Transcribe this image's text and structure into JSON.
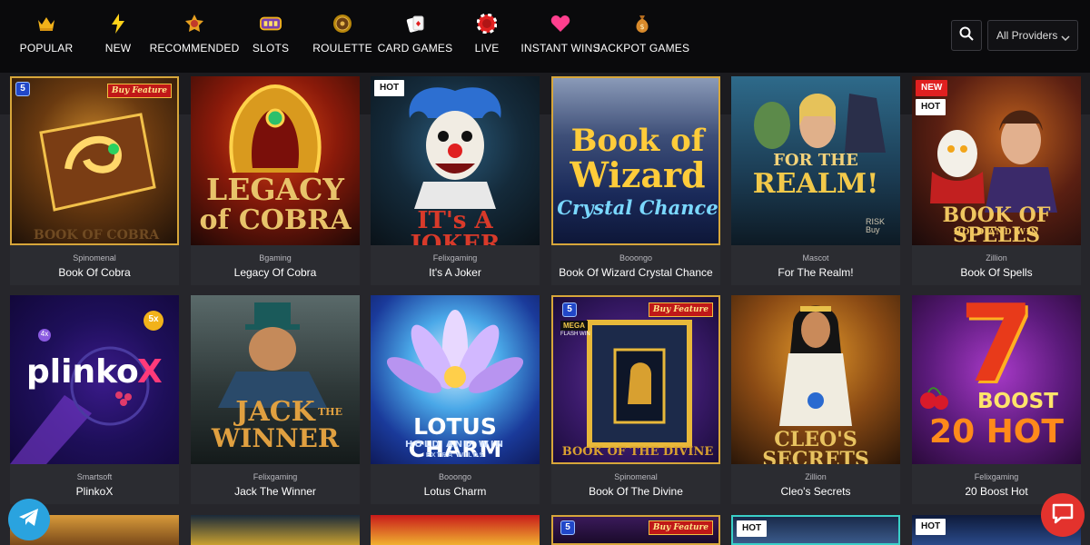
{
  "nav": {
    "items": [
      {
        "label": "POPULAR",
        "icon": "crown-icon"
      },
      {
        "label": "NEW",
        "icon": "lightning-icon"
      },
      {
        "label": "RECOMMENDED",
        "icon": "medal-icon"
      },
      {
        "label": "SLOTS",
        "icon": "slot-machine-icon"
      },
      {
        "label": "ROULETTE",
        "icon": "roulette-icon"
      },
      {
        "label": "CARD GAMES",
        "icon": "cards-icon"
      },
      {
        "label": "LIVE",
        "icon": "chip-icon"
      },
      {
        "label": "INSTANT WINS",
        "icon": "heart-icon"
      },
      {
        "label": "JACKPOT GAMES",
        "icon": "money-bag-icon"
      }
    ],
    "provider_select": {
      "value": "All Providers"
    }
  },
  "games": [
    {
      "provider": "Spinomenal",
      "name": "Book Of Cobra",
      "art_title": "BOOK OF COBRA",
      "badge": "",
      "buy_feature": "Buy Feature",
      "mark": "5"
    },
    {
      "provider": "Bgaming",
      "name": "Legacy Of Cobra",
      "art_title_1": "LEGACY",
      "art_title_2": "of COBRA"
    },
    {
      "provider": "Felixgaming",
      "name": "It's A Joker",
      "badge": "HOT",
      "art_title": "IT's A JOKER"
    },
    {
      "provider": "Booongo",
      "name": "Book Of Wizard Crystal Chance",
      "art_title_1": "Book of",
      "art_title_2": "Wizard",
      "art_title_3": "Crystal Chance"
    },
    {
      "provider": "Mascot",
      "name": "For The Realm!",
      "art_title_1": "FOR THE",
      "art_title_2": "REALM!",
      "art_sub": "RISK Buy"
    },
    {
      "provider": "Zillion",
      "name": "Book Of Spells",
      "badge_new": "NEW",
      "badge": "HOT",
      "art_title": "BOOK OF SPELLS",
      "art_sub": "HOLD AND WIN"
    },
    {
      "provider": "Smartsoft",
      "name": "PlinkoX",
      "art_title": "plinko",
      "art_x": "X",
      "art_mult": "5x",
      "art_mult2": "4x"
    },
    {
      "provider": "Felixgaming",
      "name": "Jack The Winner",
      "art_title_1": "JACK",
      "art_the": "THE",
      "art_title_2": "WINNER"
    },
    {
      "provider": "Booongo",
      "name": "Lotus Charm",
      "art_title": "LOTUS CHARM",
      "art_sub": "HOLD AND WIN",
      "art_sub2": "EXTRA WILDS"
    },
    {
      "provider": "Spinomenal",
      "name": "Book Of The Divine",
      "buy_feature": "Buy Feature",
      "mark": "5",
      "art_mega": "MEGA",
      "art_flash": "FLASH WIN",
      "art_title": "BOOK OF THE DIVINE"
    },
    {
      "provider": "Zillion",
      "name": "Cleo's Secrets",
      "art_title": "CLEO'S SECRETS"
    },
    {
      "provider": "Felixgaming",
      "name": "20 Boost Hot",
      "art_seven": "7",
      "art_boost": "BOOST",
      "art_title": "20 HOT"
    }
  ],
  "row3": [
    {
      "badge": ""
    },
    {
      "badge": ""
    },
    {
      "badge": ""
    },
    {
      "badge": "",
      "buy_feature": "Buy Feature",
      "mark": "5"
    },
    {
      "badge": "HOT"
    },
    {
      "badge": "HOT"
    }
  ],
  "colors": {
    "accent": "#d7a63a",
    "hot_badge": "#ffffff",
    "new_badge": "#e02020",
    "telegram": "#2aa3df",
    "chat": "#e3322d"
  }
}
